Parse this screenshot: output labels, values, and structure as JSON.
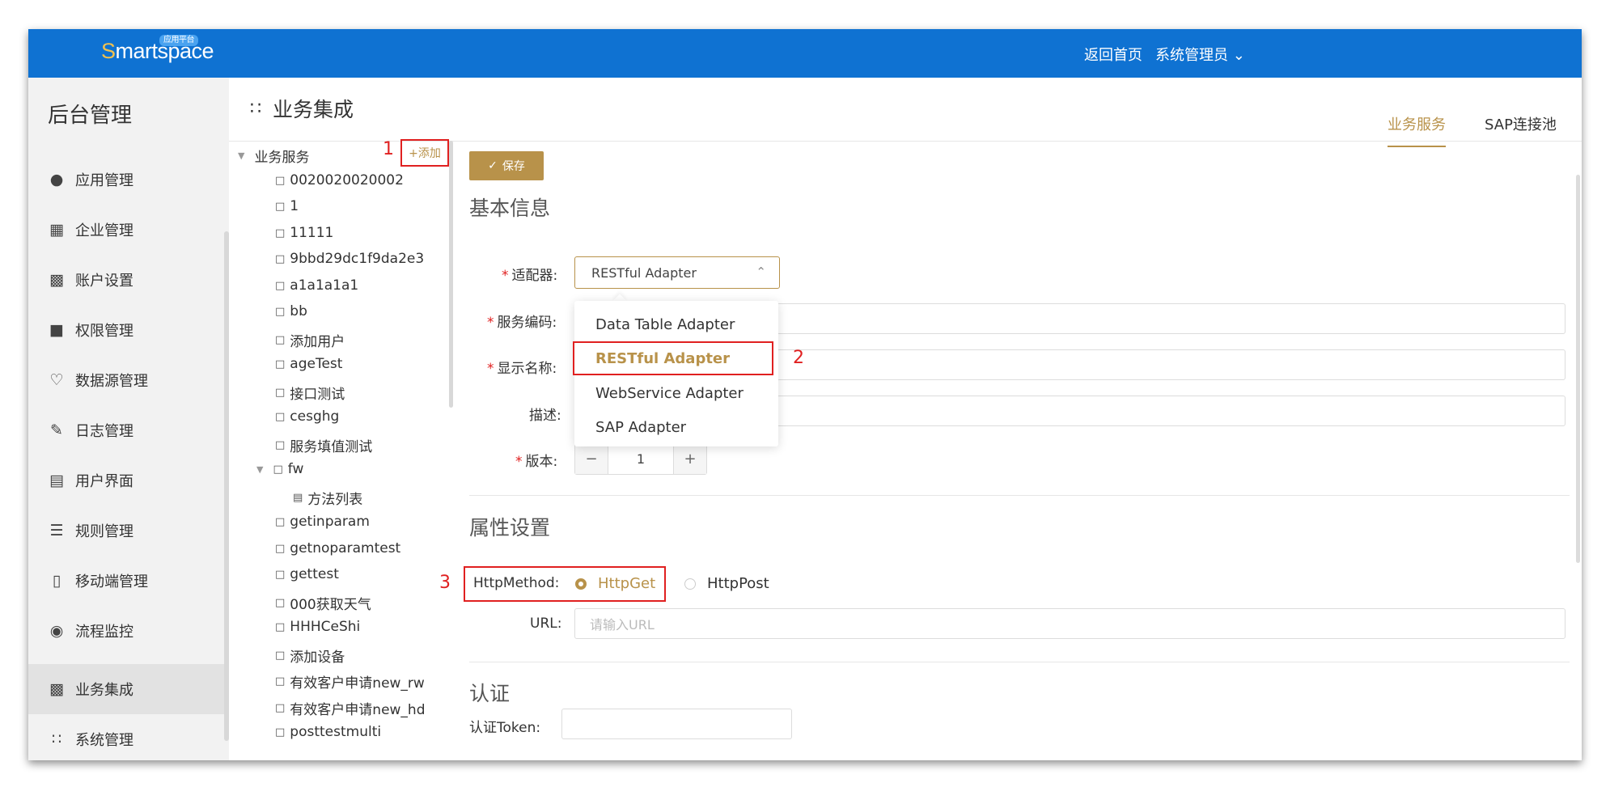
{
  "topbar": {
    "logo_text": "martspace",
    "logo_s": "S",
    "logo_badge": "应用平台",
    "home_link": "返回首页",
    "user_menu": "系统管理员 ⌄"
  },
  "sidebar": {
    "title": "后台管理",
    "items": [
      {
        "label": "应用管理",
        "icon": "user-gear-icon"
      },
      {
        "label": "企业管理",
        "icon": "building-icon"
      },
      {
        "label": "账户设置",
        "icon": "account-settings-icon"
      },
      {
        "label": "权限管理",
        "icon": "permission-icon"
      },
      {
        "label": "数据源管理",
        "icon": "heart-icon"
      },
      {
        "label": "日志管理",
        "icon": "pen-icon"
      },
      {
        "label": "用户界面",
        "icon": "layout-icon"
      },
      {
        "label": "规则管理",
        "icon": "list-icon"
      },
      {
        "label": "移动端管理",
        "icon": "mobile-icon"
      },
      {
        "label": "流程监控",
        "icon": "camera-icon"
      },
      {
        "label": "业务集成",
        "icon": "book-icon",
        "active": true
      },
      {
        "label": "系统管理",
        "icon": "apps-icon"
      }
    ]
  },
  "header": {
    "page_title": "业务集成",
    "tabs": [
      {
        "label": "业务服务",
        "active": true
      },
      {
        "label": "SAP连接池",
        "active": false
      }
    ]
  },
  "tree": {
    "root": "业务服务",
    "add_label": "+添加",
    "items": [
      "0020020020002",
      "1",
      "11111",
      "9bbd29dc1f9da2e3",
      "a1a1a1a1",
      "bb",
      "添加用户",
      "ageTest",
      "接口测试",
      "cesghg",
      "服务填值测试",
      "fw",
      "方法列表",
      "getinparam",
      "getnoparamtest",
      "gettest",
      "000获取天气",
      "HHHCeShi",
      "添加设备",
      "有效客户申请new_rw",
      "有效客户申请new_hd",
      "posttestmulti"
    ]
  },
  "annotations": {
    "one": "1",
    "two": "2",
    "three": "3"
  },
  "form": {
    "save_label": "保存",
    "basic_title": "基本信息",
    "adapter_label": "适配器:",
    "adapter_value": "RESTful Adapter",
    "service_code_label": "服务编码:",
    "display_name_label": "显示名称:",
    "desc_label": "描述:",
    "version_label": "版本:",
    "version_value": "1",
    "minus": "−",
    "plus": "+",
    "required_mark": "*",
    "dropdown_options": [
      "Data Table Adapter",
      "RESTful Adapter",
      "WebService Adapter",
      "SAP Adapter"
    ],
    "attr_title": "属性设置",
    "http_method_label": "HttpMethod:",
    "http_get": "HttpGet",
    "http_post": "HttpPost",
    "url_label": "URL:",
    "url_placeholder": "请输入URL",
    "auth_title": "认证",
    "auth_token_label": "认证Token:"
  },
  "colors": {
    "topbar": "#0f72d2",
    "accent": "#b8924a",
    "annotation": "#e02020"
  }
}
